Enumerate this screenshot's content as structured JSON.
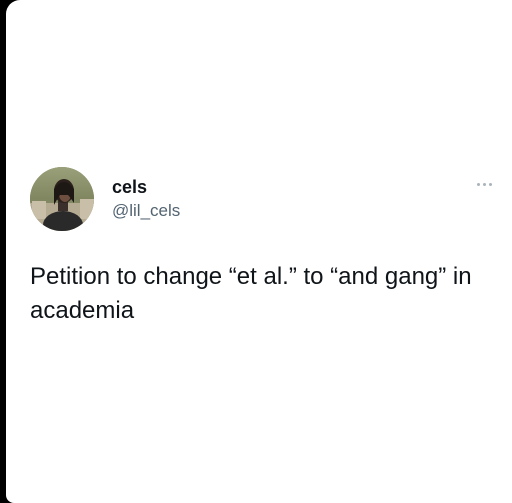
{
  "author": {
    "display_name": "cels",
    "handle": "@lil_cels",
    "avatar_icon": "profile-photo"
  },
  "tweet": {
    "text": "Petition to change “et al.” to “and gang” in academia"
  },
  "menu": {
    "icon": "more-options-icon"
  },
  "colors": {
    "background": "#ffffff",
    "text_primary": "#0f1419",
    "text_secondary": "#536471",
    "frame": "#000000"
  }
}
